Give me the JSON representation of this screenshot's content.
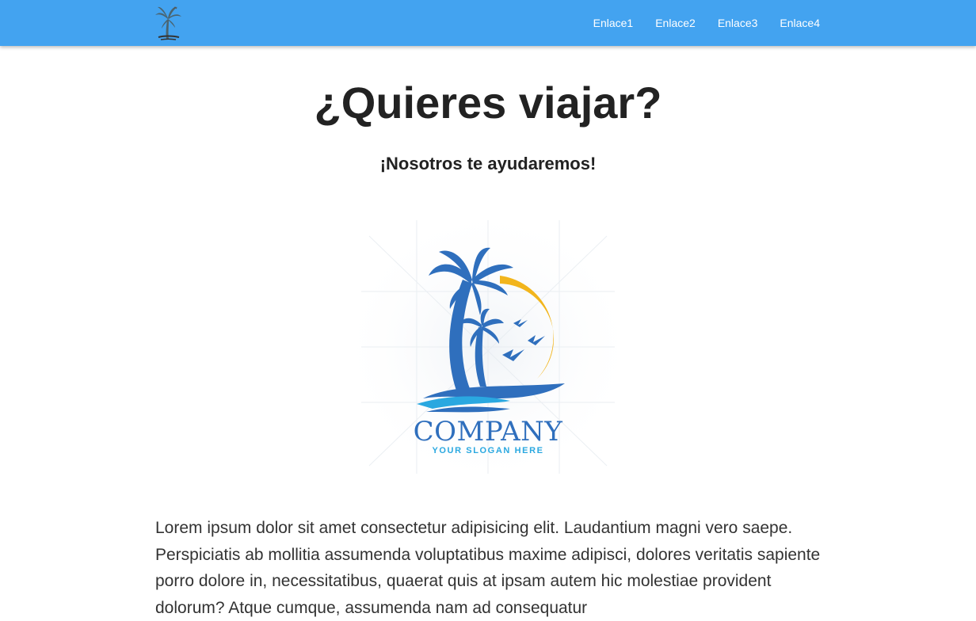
{
  "navbar": {
    "background": "#43a3f0",
    "logo_icon": "palm-tree-icon",
    "links": [
      "Enlace1",
      "Enlace2",
      "Enlace3",
      "Enlace4"
    ]
  },
  "hero": {
    "title": "¿Quieres viajar?",
    "subtitle": "¡Nosotros te ayudaremos!"
  },
  "logo_image": {
    "brand_text": "COMPANY",
    "slogan_text": "YOUR SLOGAN HERE",
    "colors": {
      "blue": "#2f6fbd",
      "light_blue": "#2aa8e0",
      "sun": "#f2b51c"
    }
  },
  "body": {
    "paragraph": "Lorem ipsum dolor sit amet consectetur adipisicing elit. Laudantium magni vero saepe. Perspiciatis ab mollitia assumenda voluptatibus maxime adipisci, dolores veritatis sapiente porro dolore in, necessitatibus, quaerat quis at ipsam autem hic molestiae provident dolorum? Atque cumque, assumenda nam ad consequatur"
  }
}
